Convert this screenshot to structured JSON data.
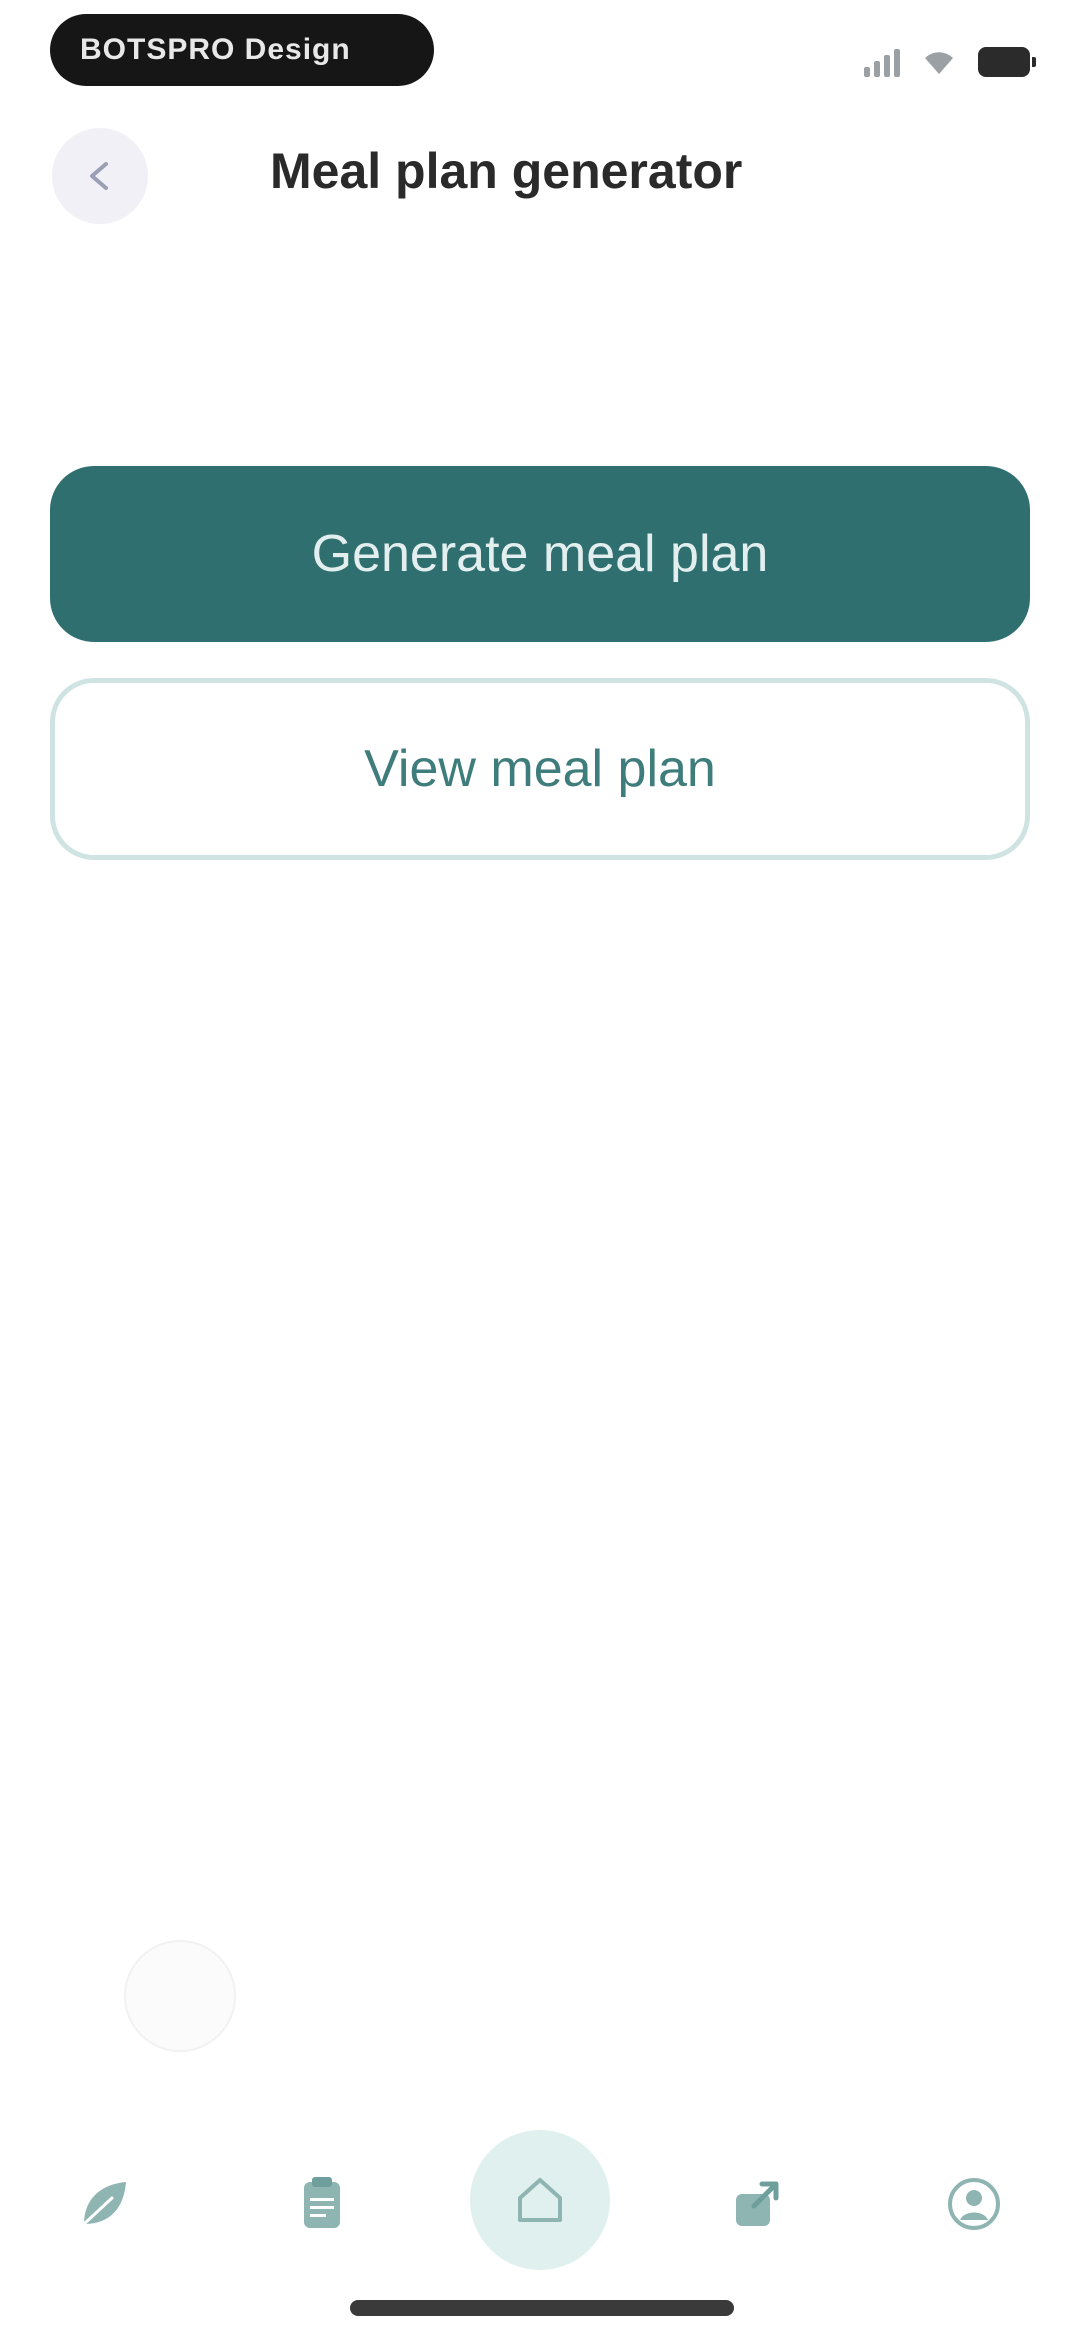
{
  "status_bar": {
    "pill_text": "BOTSPRO Design"
  },
  "header": {
    "title": "Meal plan generator",
    "back_icon": "arrow-left-icon"
  },
  "actions": {
    "generate_label": "Generate meal plan",
    "view_label": "View meal plan"
  },
  "bottom_nav": {
    "items": [
      {
        "icon": "leaf-icon"
      },
      {
        "icon": "clipboard-icon"
      },
      {
        "icon": "home-icon"
      },
      {
        "icon": "share-icon"
      },
      {
        "icon": "profile-icon"
      }
    ]
  },
  "colors": {
    "primary": "#2f6f70",
    "primary_text": "#e3efee",
    "secondary_border": "#cfe3e2",
    "secondary_text": "#3f7d7c",
    "nav_icon": "#8fb5b3",
    "home_bg": "#dff0ef"
  }
}
